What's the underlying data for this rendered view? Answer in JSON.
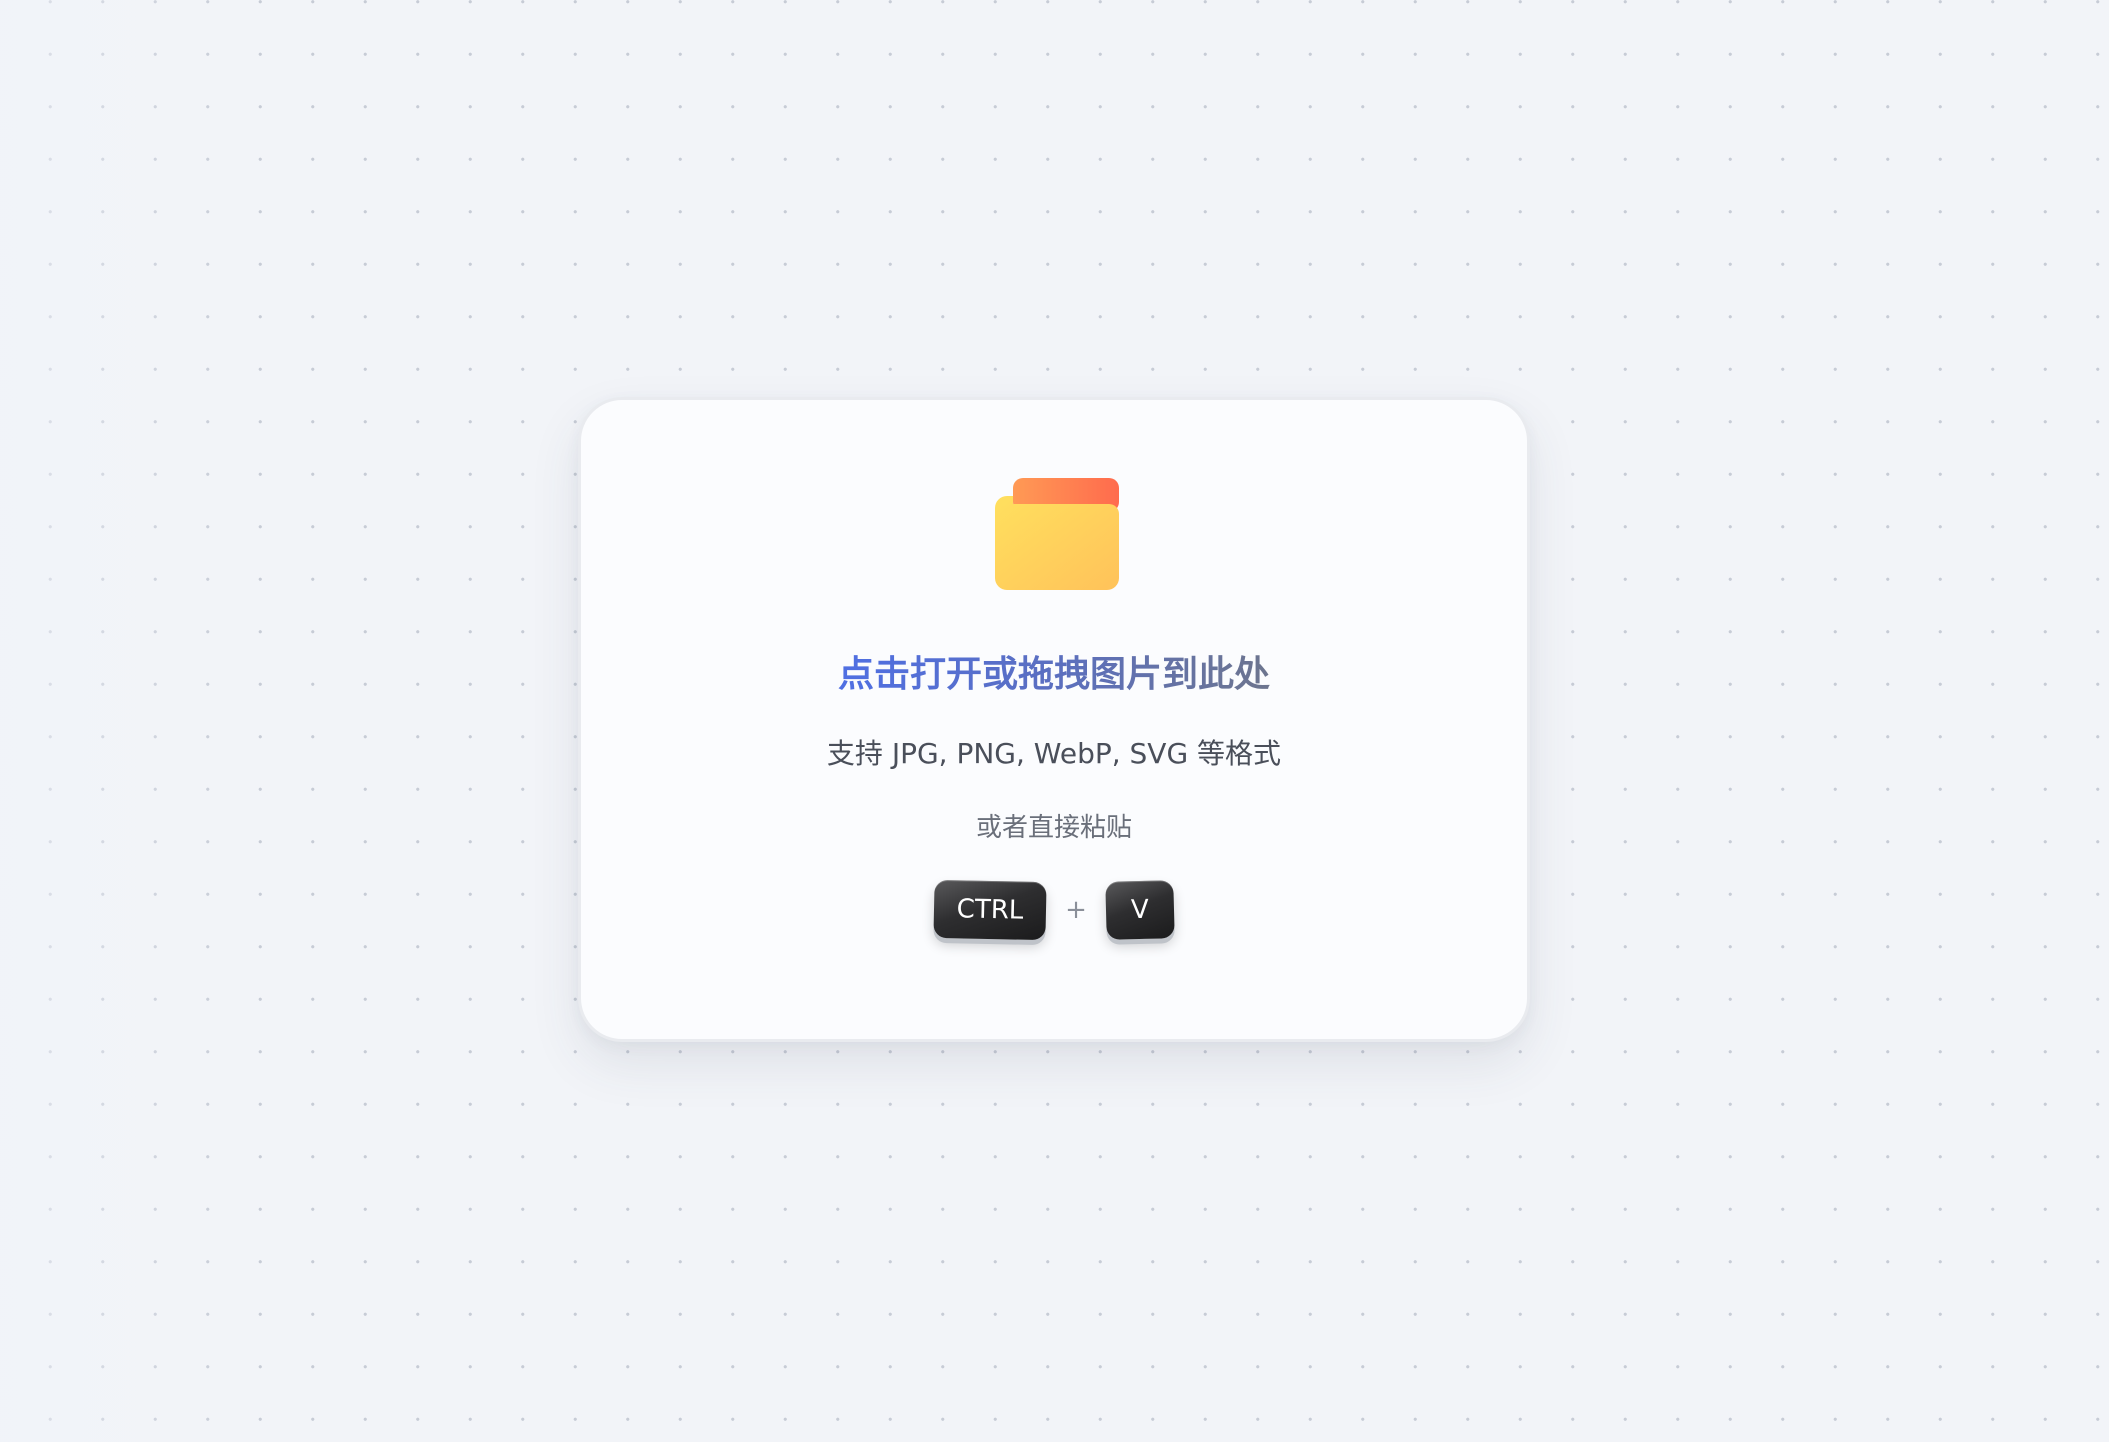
{
  "drop_zone": {
    "title": "点击打开或拖拽图片到此处",
    "formats_text": "支持 JPG, PNG, WebP, SVG 等格式",
    "paste_hint": "或者直接粘贴",
    "shortcut": {
      "key1": "CTRL",
      "plus": "+",
      "key2": "V"
    },
    "icon": "folder-icon"
  },
  "colors": {
    "title_gradient_start": "#4f6fe3",
    "title_gradient_end": "#6d758e",
    "folder_back": "#ff7a4d",
    "folder_front": "#ffd55a",
    "key_background": "#2e2e30",
    "page_background": "#f2f4f8"
  }
}
